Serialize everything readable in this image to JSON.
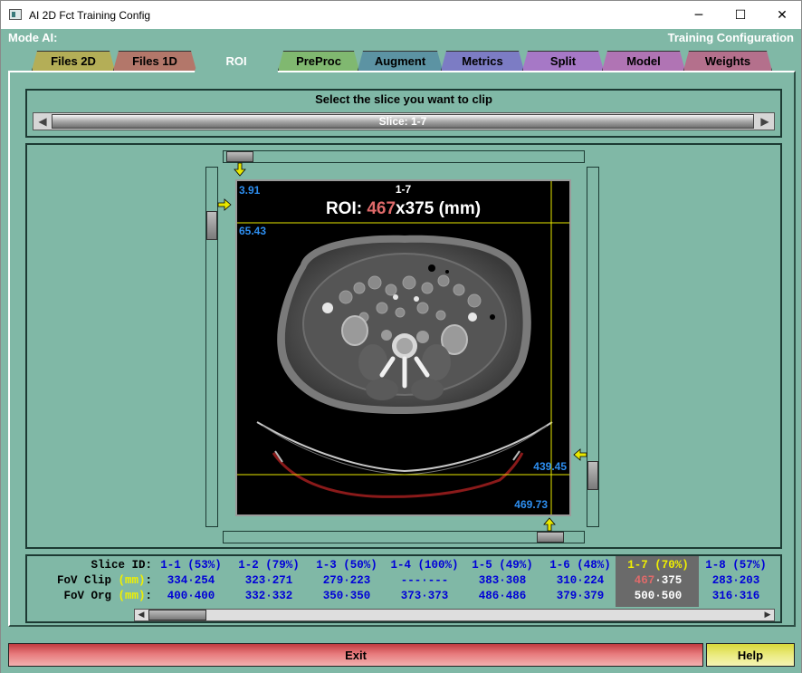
{
  "window": {
    "title": "AI 2D Fct Training Config",
    "minimize_glyph": "─",
    "maximize_glyph": "☐",
    "close_glyph": "✕"
  },
  "header": {
    "mode_label": "Mode AI:",
    "config_label": "Training Configuration"
  },
  "tabs": [
    {
      "label": "Files 2D",
      "color": "#b4ae57"
    },
    {
      "label": "Files 1D",
      "color": "#b3776a"
    },
    {
      "label": "ROI",
      "color": "#80b8a6",
      "active": true
    },
    {
      "label": "PreProc",
      "color": "#80b870"
    },
    {
      "label": "Augment",
      "color": "#5c93a3"
    },
    {
      "label": "Metrics",
      "color": "#7c7cc4"
    },
    {
      "label": "Split",
      "color": "#a678c6"
    },
    {
      "label": "Model",
      "color": "#b074b4"
    },
    {
      "label": "Weights",
      "color": "#b4708c"
    }
  ],
  "slice_selector": {
    "prompt": "Select the slice you want to clip",
    "label": "Slice: 1-7",
    "left_arrow": "◀",
    "right_arrow": "▶"
  },
  "viewer": {
    "slice_id": "1-7",
    "roi_prefix": "ROI:",
    "roi_width": "467",
    "roi_x": "x",
    "roi_height": "375",
    "roi_unit": "(mm)",
    "top_value": "3.91",
    "left_value": "65.43",
    "right_value": "439.45",
    "bottom_value": "469.73",
    "value_color": "#2d8ef0",
    "line_color": "#e8e800"
  },
  "table": {
    "row_headers": {
      "slice_id": "Slice ID:",
      "fov_clip": "FoV Clip",
      "fov_org": "FoV Org",
      "unit": "(mm)",
      "colon": ":"
    },
    "columns": [
      {
        "id": "1-1 (53%)",
        "clip": "334·254",
        "org": "400·400"
      },
      {
        "id": "1-2 (79%)",
        "clip": "323·271",
        "org": "332·332"
      },
      {
        "id": "1-3 (50%)",
        "clip": "279·223",
        "org": "350·350"
      },
      {
        "id": "1-4 (100%)",
        "clip": "---·---",
        "org": "373·373"
      },
      {
        "id": "1-5 (49%)",
        "clip": "383·308",
        "org": "486·486"
      },
      {
        "id": "1-6 (48%)",
        "clip": "310·224",
        "org": "379·379"
      },
      {
        "id": "1-7 (70%)",
        "clip": "467·375",
        "org": "500·500",
        "selected": true
      },
      {
        "id": "1-8 (57%)",
        "clip": "283·203",
        "org": "316·316"
      }
    ],
    "scroll_left": "◀",
    "scroll_right": "▶"
  },
  "buttons": {
    "exit": "Exit",
    "help": "Help"
  }
}
